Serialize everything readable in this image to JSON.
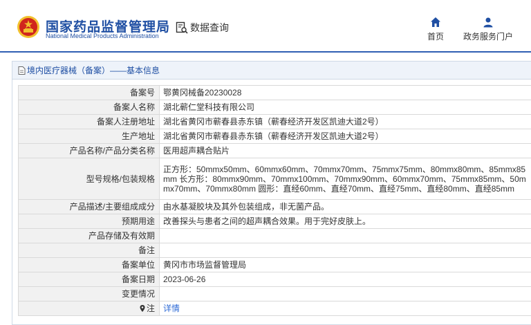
{
  "header": {
    "logo_cn": "国家药品监督管理局",
    "logo_en": "National Medical Products Administration",
    "data_query": "数据查询",
    "nav": {
      "home": "首页",
      "service": "政务服务门户"
    }
  },
  "panel": {
    "title": "境内医疗器械（备案）——基本信息"
  },
  "rows": [
    {
      "label": "备案号",
      "value": "鄂黄冈械备20230028"
    },
    {
      "label": "备案人名称",
      "value": "湖北蕲仁堂科技有限公司"
    },
    {
      "label": "备案人注册地址",
      "value": "湖北省黄冈市蕲春县赤东镇（蕲春经济开发区凯迪大道2号）"
    },
    {
      "label": "生产地址",
      "value": "湖北省黄冈市蕲春县赤东镇（蕲春经济开发区凯迪大道2号）"
    },
    {
      "label": "产品名称/产品分类名称",
      "value": "医用超声耦合贴片"
    },
    {
      "label": "型号规格/包装规格",
      "value": "正方形：50mmx50mm、60mmx60mm、70mmx70mm、75mmx75mm、80mmx80mm、85mmx85mm 长方形：80mmx90mm、70mmx100mm、70mmx90mm、60mmx70mm、75mmx85mm、50mmx70mm、70mmx80mm 圆形：直经60mm、直经70mm、直经75mm、直经80mm、直经85mm"
    },
    {
      "label": "产品描述/主要组成成分",
      "value": "由水基凝胶块及其外包装组成，非无菌产品。"
    },
    {
      "label": "预期用途",
      "value": "改善探头与患者之间的超声耦合效果。用于完好皮肤上。"
    },
    {
      "label": "产品存储及有效期",
      "value": ""
    },
    {
      "label": "备注",
      "value": ""
    },
    {
      "label": "备案单位",
      "value": "黄冈市市场监督管理局"
    },
    {
      "label": "备案日期",
      "value": "2023-06-26"
    },
    {
      "label": "变更情况",
      "value": ""
    },
    {
      "label": "注",
      "value": "详情"
    }
  ],
  "colors": {
    "brand_blue": "#1f4fa3",
    "link_blue": "#2f6bd6",
    "emblem_red": "#d0261d",
    "emblem_gold": "#f2c12e"
  }
}
